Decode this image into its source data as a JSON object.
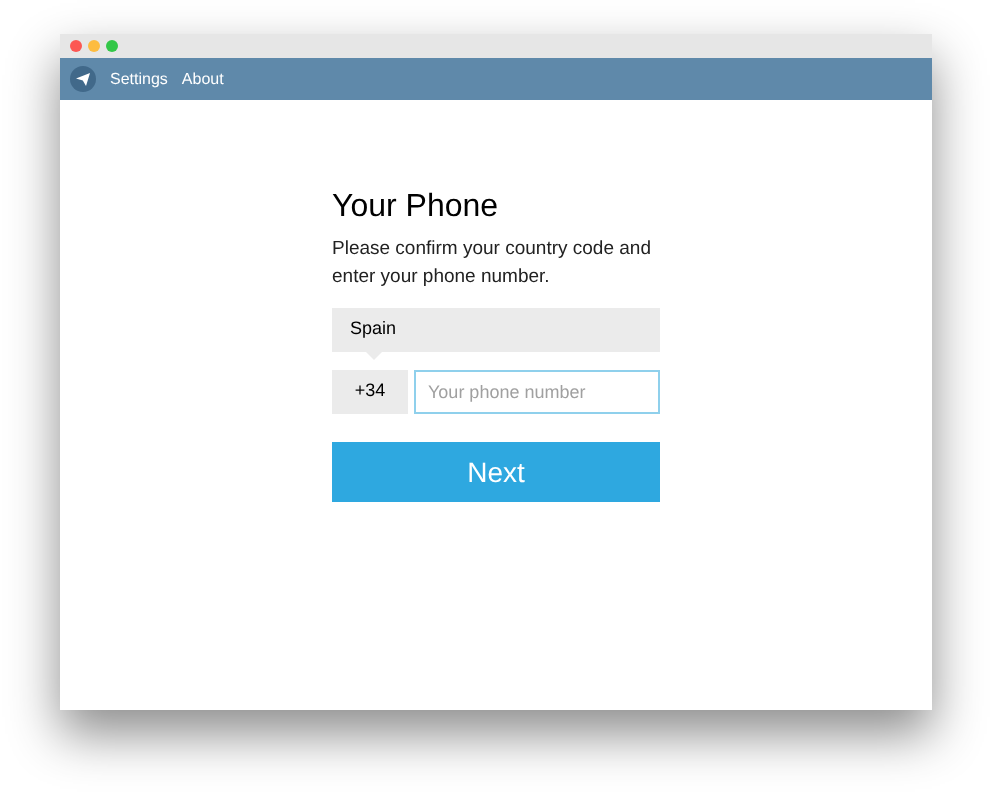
{
  "menu": [
    {
      "label": "Settings"
    },
    {
      "label": "About"
    }
  ],
  "heading": "Your Phone",
  "description": "Please confirm your country code and enter your phone number.",
  "country": {
    "value": "Spain"
  },
  "code": "+34",
  "phone": {
    "placeholder": "Your phone number"
  },
  "next_button": "Next"
}
